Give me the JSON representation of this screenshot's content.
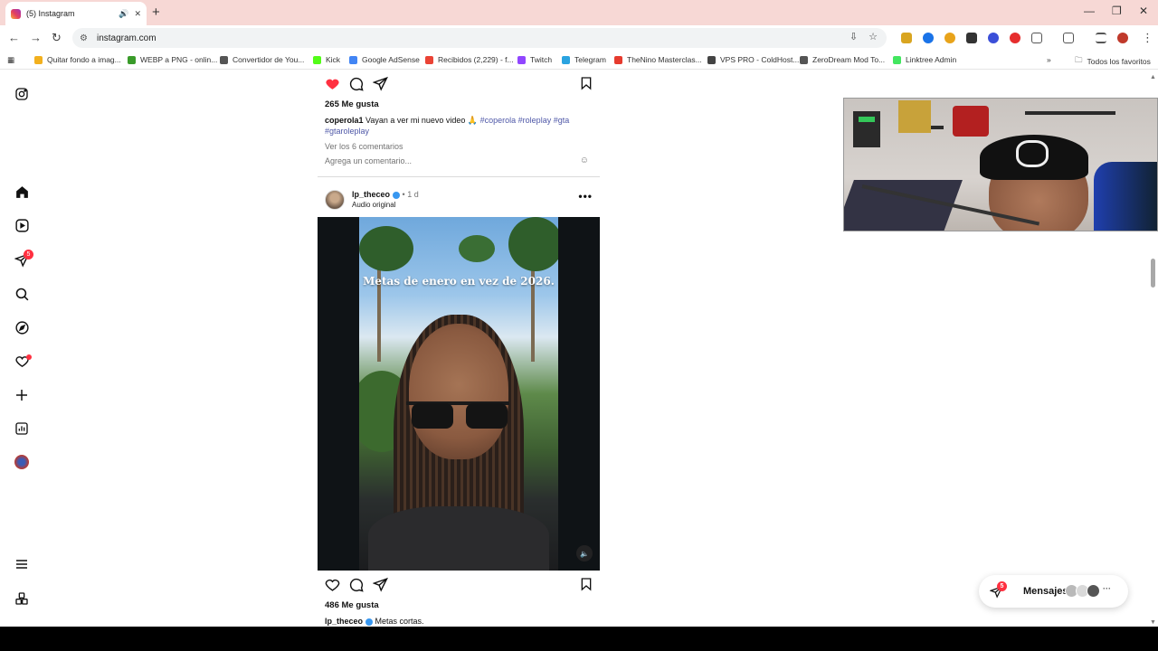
{
  "browser": {
    "tab_title": "(5) Instagram",
    "url": "instagram.com",
    "all_bookmarks_label": "Todos los favoritos"
  },
  "bookmarks": [
    {
      "label": "Quitar fondo a imag...",
      "color": "#f2b01e"
    },
    {
      "label": "WEBP a PNG - onlin...",
      "color": "#3a9b2a"
    },
    {
      "label": "Convertidor de You...",
      "color": "#555555"
    },
    {
      "label": "Kick",
      "color": "#53fc18"
    },
    {
      "label": "Google AdSense",
      "color": "#4285f4"
    },
    {
      "label": "Recibidos (2,229) - f...",
      "color": "#ea4335"
    },
    {
      "label": "Twitch",
      "color": "#9146ff"
    },
    {
      "label": "Telegram",
      "color": "#2aa3e0"
    },
    {
      "label": "TheNino Masterclas...",
      "color": "#e63b2e"
    },
    {
      "label": "VPS PRO - ColdHost...",
      "color": "#444444"
    },
    {
      "label": "ZeroDream Mod To...",
      "color": "#555555"
    },
    {
      "label": "Linktree Admin",
      "color": "#43e660"
    }
  ],
  "sidebar": {
    "notifications_badge": "5"
  },
  "post1": {
    "likes": "265 Me gusta",
    "username": "coperola1",
    "caption_text": " Vayan a ver mi nuevo video 🙏 ",
    "tags": "#coperola #roleplay #gta #gtaroleplay",
    "view_comments": "Ver los 6 comentarios",
    "comment_placeholder": "Agrega un comentario...",
    "liked": true
  },
  "post2": {
    "username": "lp_theceo",
    "time": "1 d",
    "audio": "Audio original",
    "video_text": "Metas de enero en vez de 2026.",
    "likes": "486 Me gusta",
    "caption_text": "Metas cortas."
  },
  "messages": {
    "label": "Mensajes",
    "badge": "5"
  },
  "colors": {
    "accent_like": "#ff3040",
    "hashtag": "#4f58a8",
    "verified": "#3897f0",
    "tabbar": "#f7d8d5"
  }
}
